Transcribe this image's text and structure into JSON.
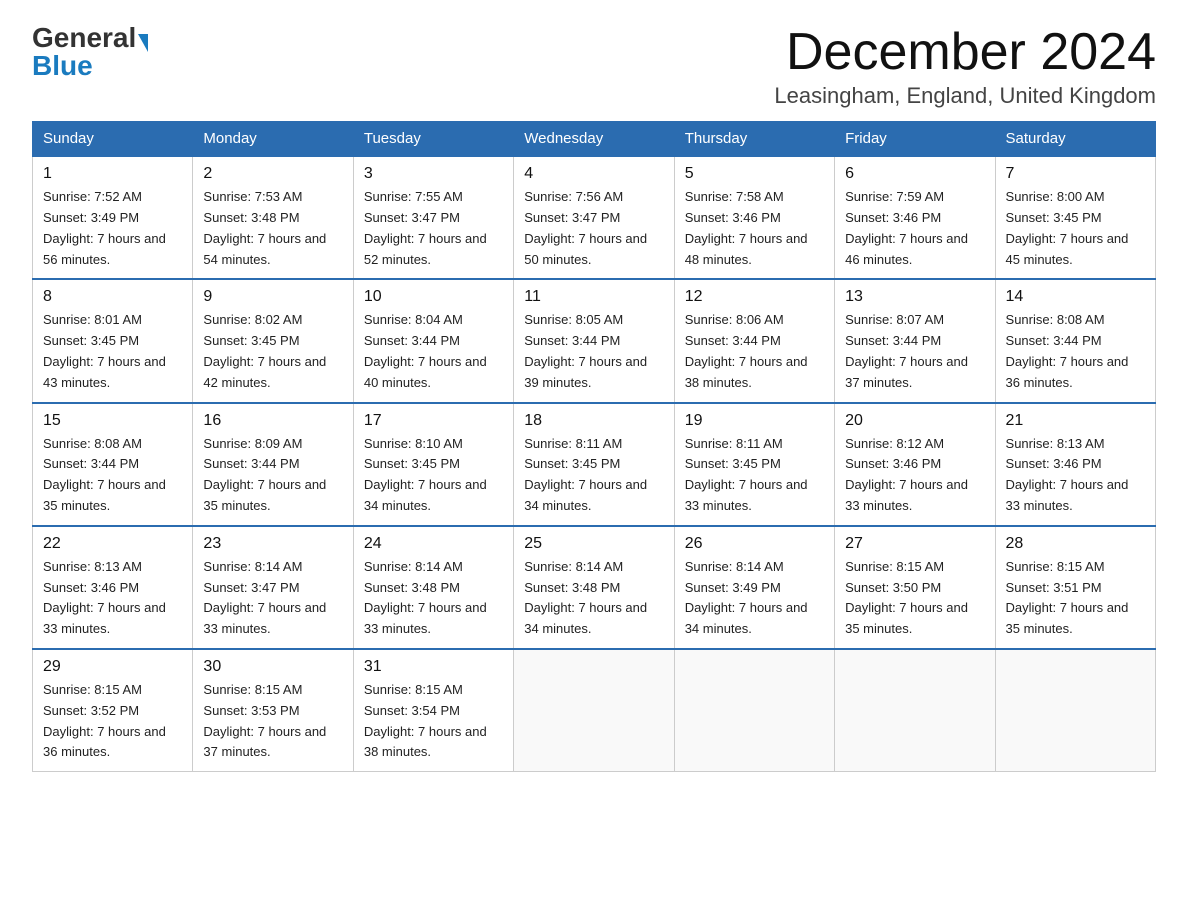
{
  "header": {
    "logo_general": "General",
    "logo_blue": "Blue",
    "title": "December 2024",
    "subtitle": "Leasingham, England, United Kingdom"
  },
  "weekdays": [
    "Sunday",
    "Monday",
    "Tuesday",
    "Wednesday",
    "Thursday",
    "Friday",
    "Saturday"
  ],
  "weeks": [
    [
      {
        "day": "1",
        "sunrise": "7:52 AM",
        "sunset": "3:49 PM",
        "daylight": "7 hours and 56 minutes."
      },
      {
        "day": "2",
        "sunrise": "7:53 AM",
        "sunset": "3:48 PM",
        "daylight": "7 hours and 54 minutes."
      },
      {
        "day": "3",
        "sunrise": "7:55 AM",
        "sunset": "3:47 PM",
        "daylight": "7 hours and 52 minutes."
      },
      {
        "day": "4",
        "sunrise": "7:56 AM",
        "sunset": "3:47 PM",
        "daylight": "7 hours and 50 minutes."
      },
      {
        "day": "5",
        "sunrise": "7:58 AM",
        "sunset": "3:46 PM",
        "daylight": "7 hours and 48 minutes."
      },
      {
        "day": "6",
        "sunrise": "7:59 AM",
        "sunset": "3:46 PM",
        "daylight": "7 hours and 46 minutes."
      },
      {
        "day": "7",
        "sunrise": "8:00 AM",
        "sunset": "3:45 PM",
        "daylight": "7 hours and 45 minutes."
      }
    ],
    [
      {
        "day": "8",
        "sunrise": "8:01 AM",
        "sunset": "3:45 PM",
        "daylight": "7 hours and 43 minutes."
      },
      {
        "day": "9",
        "sunrise": "8:02 AM",
        "sunset": "3:45 PM",
        "daylight": "7 hours and 42 minutes."
      },
      {
        "day": "10",
        "sunrise": "8:04 AM",
        "sunset": "3:44 PM",
        "daylight": "7 hours and 40 minutes."
      },
      {
        "day": "11",
        "sunrise": "8:05 AM",
        "sunset": "3:44 PM",
        "daylight": "7 hours and 39 minutes."
      },
      {
        "day": "12",
        "sunrise": "8:06 AM",
        "sunset": "3:44 PM",
        "daylight": "7 hours and 38 minutes."
      },
      {
        "day": "13",
        "sunrise": "8:07 AM",
        "sunset": "3:44 PM",
        "daylight": "7 hours and 37 minutes."
      },
      {
        "day": "14",
        "sunrise": "8:08 AM",
        "sunset": "3:44 PM",
        "daylight": "7 hours and 36 minutes."
      }
    ],
    [
      {
        "day": "15",
        "sunrise": "8:08 AM",
        "sunset": "3:44 PM",
        "daylight": "7 hours and 35 minutes."
      },
      {
        "day": "16",
        "sunrise": "8:09 AM",
        "sunset": "3:44 PM",
        "daylight": "7 hours and 35 minutes."
      },
      {
        "day": "17",
        "sunrise": "8:10 AM",
        "sunset": "3:45 PM",
        "daylight": "7 hours and 34 minutes."
      },
      {
        "day": "18",
        "sunrise": "8:11 AM",
        "sunset": "3:45 PM",
        "daylight": "7 hours and 34 minutes."
      },
      {
        "day": "19",
        "sunrise": "8:11 AM",
        "sunset": "3:45 PM",
        "daylight": "7 hours and 33 minutes."
      },
      {
        "day": "20",
        "sunrise": "8:12 AM",
        "sunset": "3:46 PM",
        "daylight": "7 hours and 33 minutes."
      },
      {
        "day": "21",
        "sunrise": "8:13 AM",
        "sunset": "3:46 PM",
        "daylight": "7 hours and 33 minutes."
      }
    ],
    [
      {
        "day": "22",
        "sunrise": "8:13 AM",
        "sunset": "3:46 PM",
        "daylight": "7 hours and 33 minutes."
      },
      {
        "day": "23",
        "sunrise": "8:14 AM",
        "sunset": "3:47 PM",
        "daylight": "7 hours and 33 minutes."
      },
      {
        "day": "24",
        "sunrise": "8:14 AM",
        "sunset": "3:48 PM",
        "daylight": "7 hours and 33 minutes."
      },
      {
        "day": "25",
        "sunrise": "8:14 AM",
        "sunset": "3:48 PM",
        "daylight": "7 hours and 34 minutes."
      },
      {
        "day": "26",
        "sunrise": "8:14 AM",
        "sunset": "3:49 PM",
        "daylight": "7 hours and 34 minutes."
      },
      {
        "day": "27",
        "sunrise": "8:15 AM",
        "sunset": "3:50 PM",
        "daylight": "7 hours and 35 minutes."
      },
      {
        "day": "28",
        "sunrise": "8:15 AM",
        "sunset": "3:51 PM",
        "daylight": "7 hours and 35 minutes."
      }
    ],
    [
      {
        "day": "29",
        "sunrise": "8:15 AM",
        "sunset": "3:52 PM",
        "daylight": "7 hours and 36 minutes."
      },
      {
        "day": "30",
        "sunrise": "8:15 AM",
        "sunset": "3:53 PM",
        "daylight": "7 hours and 37 minutes."
      },
      {
        "day": "31",
        "sunrise": "8:15 AM",
        "sunset": "3:54 PM",
        "daylight": "7 hours and 38 minutes."
      },
      null,
      null,
      null,
      null
    ]
  ]
}
